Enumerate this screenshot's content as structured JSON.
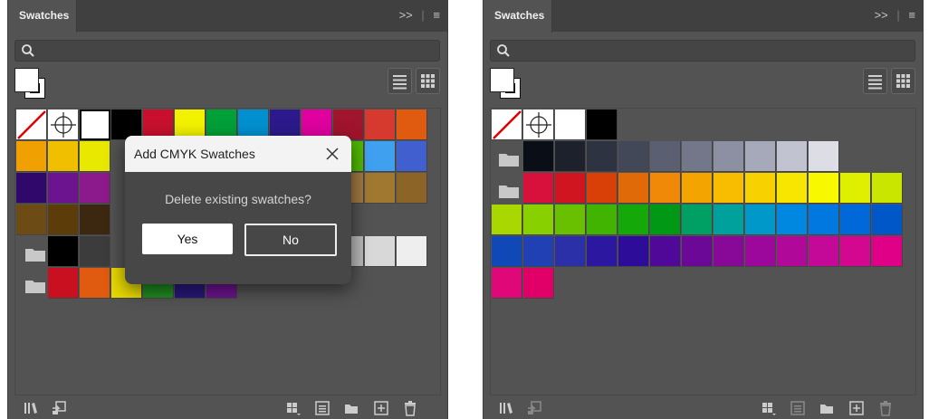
{
  "left_panel": {
    "tab_title": "Swatches",
    "rows": [
      [
        "#000000",
        "#c8102e",
        "#f2f200",
        "#00a038",
        "#0090d0",
        "#2c1a8c",
        "#e000a0",
        "#a0142c",
        "#d63a2e",
        "#e05a10"
      ],
      [
        "#f0a000",
        "#f0c000",
        "#e8e800",
        "#50b800",
        "#40a0f0",
        "#4060d0",
        "#2c108c"
      ],
      [
        "#30086c",
        "#6c1490",
        "#8c1a8c",
        "#a07840",
        "#a07830",
        "#8c6428"
      ],
      [
        "#6c4c14",
        "#5c3c08",
        "#3c2810"
      ],
      [
        "#000000",
        "#3c3c3c",
        "#b8b8b8",
        "#d8d8d8",
        "#eeeeee"
      ],
      [
        "#c81020",
        "#e05a10",
        "#e8d800",
        "#208c20",
        "#28187c",
        "#6c1490"
      ]
    ],
    "dialog": {
      "title": "Add CMYK Swatches",
      "message": "Delete existing swatches?",
      "yes_label": "Yes",
      "no_label": "No"
    }
  },
  "right_panel": {
    "tab_title": "Swatches",
    "row1": [
      "#000000"
    ],
    "group1": [
      "#0a0e16",
      "#1c212c",
      "#2e3342",
      "#434859",
      "#5a5f72",
      "#73778a",
      "#8c90a2",
      "#a6a9ba",
      "#c1c3d0",
      "#dcdde5"
    ],
    "group2": [
      "#d8103c",
      "#d01420",
      "#d84008",
      "#e06a08",
      "#f08808",
      "#f4a400",
      "#f8bc00",
      "#f8d200",
      "#f8e600",
      "#f8f800",
      "#e0ee00",
      "#c8e600"
    ],
    "row_a": [
      "#a8d800",
      "#88d000",
      "#68c000",
      "#40b400",
      "#14a808",
      "#009814",
      "#00a064",
      "#00a09c",
      "#0098c8",
      "#0088e0",
      "#0078e0",
      "#0068d8",
      "#0058c8"
    ],
    "row_b": [
      "#1048b8",
      "#2040b4",
      "#2c30a8",
      "#2c18a0",
      "#2c0c98",
      "#500898",
      "#6c0898",
      "#880898",
      "#9c089c",
      "#b00898",
      "#c40898",
      "#d40890",
      "#e00088"
    ],
    "row_c": [
      "#e00878",
      "#e00068"
    ]
  }
}
